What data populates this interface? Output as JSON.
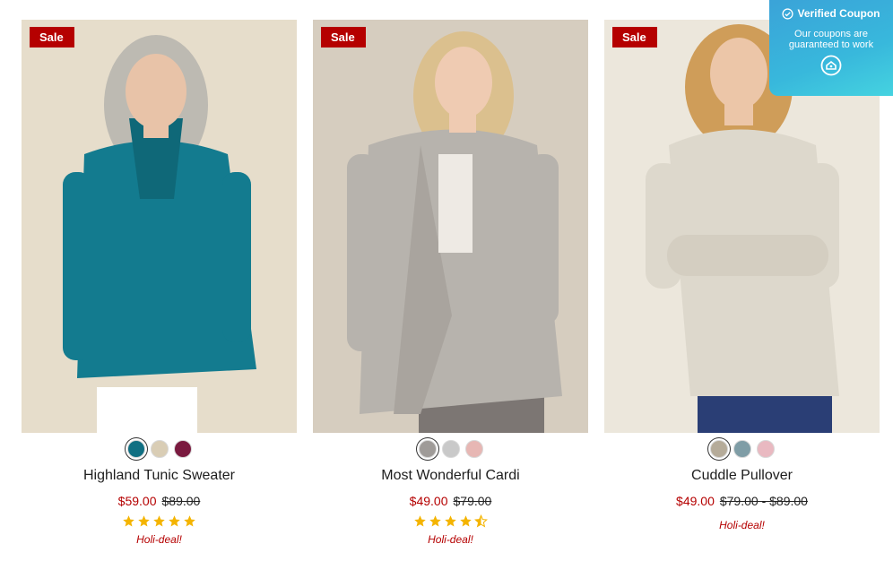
{
  "products": [
    {
      "name": "Highland Tunic Sweater",
      "badge": "Sale",
      "sale_price": "$59.00",
      "original_price": "$89.00",
      "rating": 5,
      "promo": "Holi-deal!",
      "swatches": [
        "#106f82",
        "#d9cdb5",
        "#7a1a3f"
      ],
      "selected_swatch": 0,
      "photo": {
        "bg": "#e6ddcb",
        "garment": "#137b8f",
        "hair": "#bdbab2",
        "pants": "#ffffff"
      }
    },
    {
      "name": "Most Wonderful Cardi",
      "badge": "Sale",
      "sale_price": "$49.00",
      "original_price": "$79.00",
      "rating": 4.5,
      "promo": "Holi-deal!",
      "swatches": [
        "#9f9b98",
        "#c9c9c9",
        "#e7b7b4"
      ],
      "selected_swatch": 0,
      "photo": {
        "bg": "#d6cdbf",
        "garment": "#b7b3ad",
        "hair": "#dbc08e",
        "pants": "#7c7673"
      }
    },
    {
      "name": "Cuddle Pullover",
      "badge": "Sale",
      "sale_price": "$49.00",
      "original_price": "$79.00 - $89.00",
      "rating": null,
      "promo": "Holi-deal!",
      "swatches": [
        "#b5ab99",
        "#7f9da6",
        "#e9b9c1"
      ],
      "selected_swatch": 0,
      "photo": {
        "bg": "#ece7dc",
        "garment": "#ddd8cc",
        "hair": "#cf9d59",
        "pants": "#2a3e75"
      }
    }
  ],
  "coupon": {
    "title": "Verified Coupon",
    "subtitle": "Our coupons are guaranteed to work"
  },
  "colors": {
    "accent_red": "#b50000",
    "star_gold": "#f4b400",
    "coupon_blue": "#3aaede"
  }
}
